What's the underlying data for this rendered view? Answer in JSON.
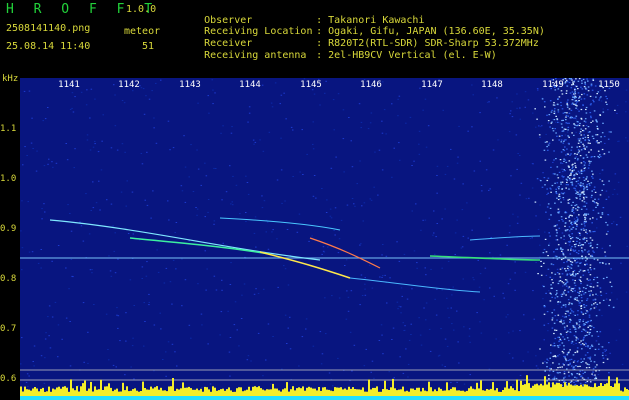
{
  "header": {
    "app_title": "H R O F F T",
    "version": "1.0.0",
    "filename": "2508141140.png",
    "datetime": "25.08.14 11:40",
    "meteor_label": "meteor",
    "meteor_count": "51"
  },
  "info": [
    {
      "label": "Observer",
      "value": ": Takanori Kawachi"
    },
    {
      "label": "Receiving Location",
      "value": ": Ogaki, Gifu, JAPAN (136.60E, 35.35N)"
    },
    {
      "label": "Receiver",
      "value": ": R820T2(RTL-SDR) SDR-Sharp 53.372MHz"
    },
    {
      "label": "Receiving antenna",
      "value": ": 2el-HB9CV Vertical (el. E-W)"
    }
  ],
  "axes": {
    "y_unit": "kHz",
    "y_ticks": [
      "1.1",
      "1.0",
      "0.9",
      "0.8",
      "0.7",
      "0.6"
    ],
    "x_ticks": [
      "1141",
      "1142",
      "1143",
      "1144",
      "1145",
      "1146",
      "1147",
      "1148",
      "1149",
      "1150"
    ]
  },
  "colors": {
    "background": "#000000",
    "label_yellow": "#d8d83a",
    "title_green": "#22d23a",
    "spectrum_blue": "#0a1a9a",
    "noise_band": "#6aa8ff",
    "power_bar": "#f4ee2a",
    "baseline_cyan": "#22e0ff"
  }
}
